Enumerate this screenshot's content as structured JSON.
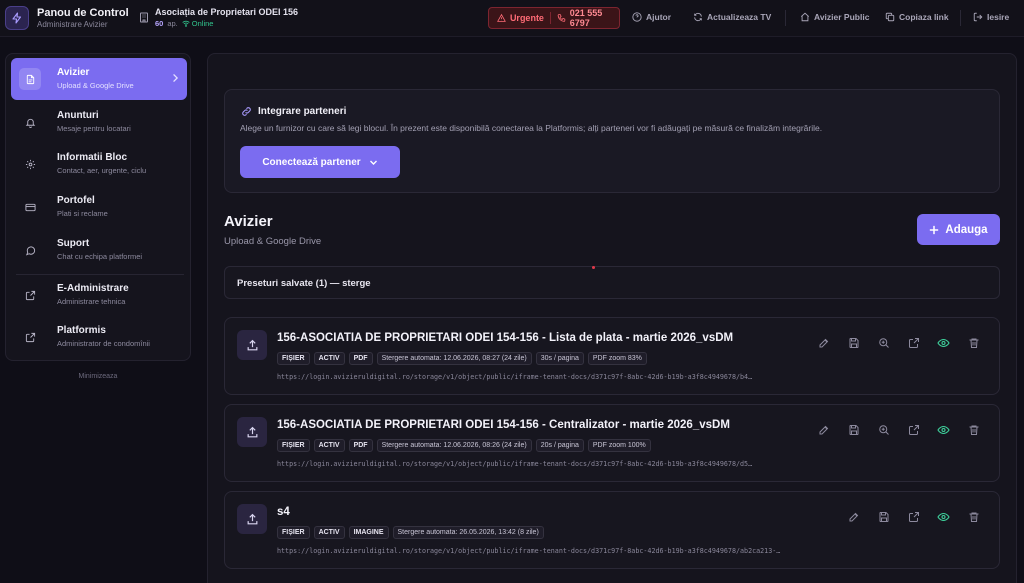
{
  "header": {
    "brand_title": "Panou de Control",
    "brand_subtitle": "Administrare Avizier",
    "association_name": "Asociația de Proprietari ODEI 156",
    "apartments_count": "60",
    "apartments_unit": "ap.",
    "status": "Online",
    "urgent_label": "Urgente",
    "urgent_phone": "021 555 6797",
    "nav": {
      "help": "Ajutor",
      "refresh_tv": "Actualizeaza TV",
      "public_board": "Avizier Public",
      "copy_link": "Copiaza link",
      "logout": "Iesire"
    }
  },
  "sidebar": {
    "items": [
      {
        "label": "Avizier",
        "sub": "Upload & Google Drive",
        "icon": "document-icon"
      },
      {
        "label": "Anunturi",
        "sub": "Mesaje pentru locatari",
        "icon": "bell-icon"
      },
      {
        "label": "Informatii Bloc",
        "sub": "Contact, aer, urgente, ciclu",
        "icon": "gear-icon"
      },
      {
        "label": "Portofel",
        "sub": "Plati si reclame",
        "icon": "card-icon"
      },
      {
        "label": "Suport",
        "sub": "Chat cu echipa platformei",
        "icon": "chat-icon"
      },
      {
        "label": "E-Administrare",
        "sub": "Administrare tehnica",
        "icon": "external-link-icon"
      },
      {
        "label": "Platformis",
        "sub": "Administrator de condomînii",
        "icon": "external-link-icon"
      }
    ],
    "minimize_label": "Minimizeaza"
  },
  "partner": {
    "title": "Integrare parteneri",
    "description": "Alege un furnizor cu care să legi blocul. În prezent este disponibilă conectarea la Platformis; alți parteneri vor fi adăugați pe măsură ce finalizăm integrările.",
    "button_label": "Conectează partener"
  },
  "section": {
    "title": "Avizier",
    "subtitle": "Upload & Google Drive",
    "add_label": "Adauga"
  },
  "presets": {
    "label": "Preseturi salvate (1) — sterge"
  },
  "cards": [
    {
      "title": "156-ASOCIATIA DE PROPRIETARI ODEI 154-156 - Lista de plata - martie 2026_vsDM",
      "badges": [
        "FIȘIER",
        "ACTIV",
        "PDF",
        "Stergere automata: 12.06.2026, 08:27 (24 zile)",
        "30s / pagina",
        "PDF zoom 83%"
      ],
      "url": "https://login.avizieruldigital.ro/storage/v1/object/public/iframe-tenant-docs/d371c97f-8abc-42d6-b19b-a3f8c4949678/b4…"
    },
    {
      "title": "156-ASOCIATIA DE PROPRIETARI ODEI 154-156 - Centralizator - martie 2026_vsDM",
      "badges": [
        "FIȘIER",
        "ACTIV",
        "PDF",
        "Stergere automata: 12.06.2026, 08:26 (24 zile)",
        "20s / pagina",
        "PDF zoom 100%"
      ],
      "url": "https://login.avizieruldigital.ro/storage/v1/object/public/iframe-tenant-docs/d371c97f-8abc-42d6-b19b-a3f8c4949678/d5…"
    },
    {
      "title": "s4",
      "badges": [
        "FIȘIER",
        "ACTIV",
        "IMAGINE",
        "Stergere automata: 26.05.2026, 13:42 (8 zile)"
      ],
      "url": "https://login.avizieruldigital.ro/storage/v1/object/public/iframe-tenant-docs/d371c97f-8abc-42d6-b19b-a3f8c4949678/ab2ca213-…"
    }
  ],
  "colors": {
    "accent": "#7b6cf0",
    "urgent": "#ff6b76",
    "online": "#31c48d",
    "visible": "#3ecf9a"
  }
}
